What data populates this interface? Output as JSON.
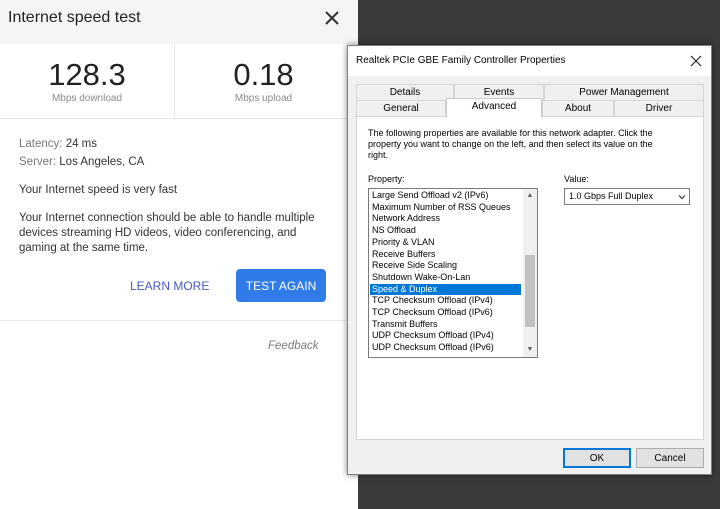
{
  "speed_test": {
    "title": "Internet speed test",
    "download": {
      "value": "128.3",
      "unit": "Mbps download"
    },
    "upload": {
      "value": "0.18",
      "unit": "Mbps upload"
    },
    "latency_label": "Latency:",
    "latency_value": "24 ms",
    "server_label": "Server:",
    "server_value": "Los Angeles, CA",
    "verdict": "Your Internet speed is very fast",
    "description": "Your Internet connection should be able to handle multiple devices streaming HD videos, video conferencing, and gaming at the same time.",
    "learn_more": "LEARN MORE",
    "test_again": "TEST AGAIN",
    "feedback": "Feedback",
    "accent_color": "#2f7be8",
    "link_color": "#4a59c4",
    "icons": {
      "close": "close-icon"
    }
  },
  "dialog": {
    "title": "Realtek PCIe GBE Family Controller Properties",
    "tabs_row1": [
      "Details",
      "Events",
      "Power Management"
    ],
    "tabs_row2": [
      "General",
      "Advanced",
      "About",
      "Driver"
    ],
    "active_tab": "Advanced",
    "description": "The following properties are available for this network adapter. Click the property you want to change on the left, and then select its value on the right.",
    "property_label": "Property:",
    "value_label": "Value:",
    "properties": [
      "Large Send Offload v2 (IPv6)",
      "Maximum Number of RSS Queues",
      "Network Address",
      "NS Offload",
      "Priority & VLAN",
      "Receive Buffers",
      "Receive Side Scaling",
      "Shutdown Wake-On-Lan",
      "Speed & Duplex",
      "TCP Checksum Offload (IPv4)",
      "TCP Checksum Offload (IPv6)",
      "Transmit Buffers",
      "UDP Checksum Offload (IPv4)",
      "UDP Checksum Offload (IPv6)"
    ],
    "selected_property": "Speed & Duplex",
    "selected_value": "1.0 Gbps Full Duplex",
    "ok": "OK",
    "cancel": "Cancel",
    "selection_color": "#0078d7",
    "icons": {
      "close": "close-icon",
      "dropdown": "chevron-down-icon",
      "scroll_up": "scroll-up-arrow-icon",
      "scroll_down": "scroll-down-arrow-icon"
    }
  }
}
